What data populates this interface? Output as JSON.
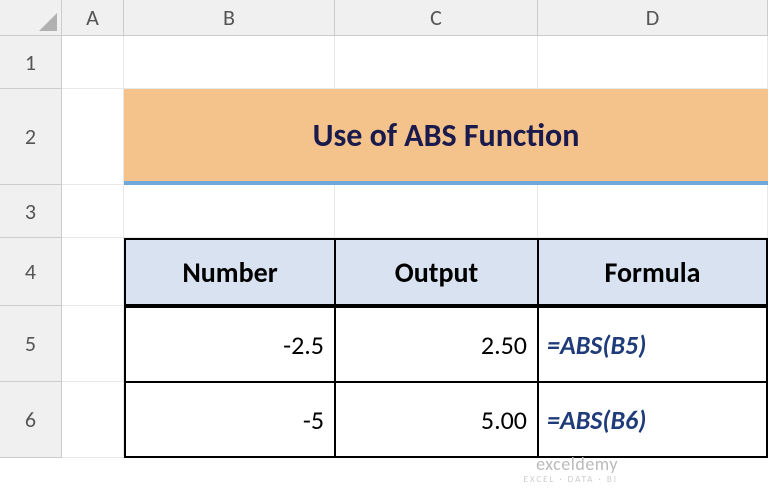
{
  "columns": [
    "A",
    "B",
    "C",
    "D"
  ],
  "rows": [
    "1",
    "2",
    "3",
    "4",
    "5",
    "6"
  ],
  "title": "Use of ABS Function",
  "headers": {
    "number": "Number",
    "output": "Output",
    "formula": "Formula"
  },
  "data": [
    {
      "number": "-2.5",
      "output": "2.50",
      "formula": "=ABS(B5)"
    },
    {
      "number": "-5",
      "output": "5.00",
      "formula": "=ABS(B6)"
    }
  ],
  "watermark": {
    "main": "exceldemy",
    "sub": "EXCEL · DATA · BI"
  },
  "chart_data": {
    "type": "table",
    "title": "Use of ABS Function",
    "columns": [
      "Number",
      "Output",
      "Formula"
    ],
    "rows": [
      [
        -2.5,
        2.5,
        "=ABS(B5)"
      ],
      [
        -5,
        5.0,
        "=ABS(B6)"
      ]
    ]
  }
}
